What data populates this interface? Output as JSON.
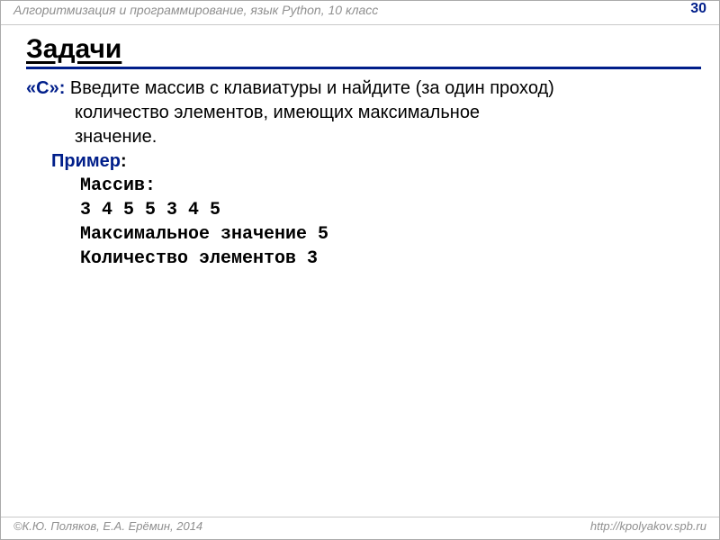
{
  "header": {
    "course": "Алгоритмизация и программирование, язык Python, 10 класс",
    "page": "30"
  },
  "title": "Задачи",
  "task": {
    "label": "«C»:",
    "line1_after_label": " Введите массив с клавиатуры и найдите (за один проход)",
    "line2": "количество элементов, имеющих максимальное",
    "line3": "значение."
  },
  "example": {
    "label": "Пример",
    "colon": ":",
    "lines": [
      "Массив:",
      "3 4 5 5 3 4 5",
      "Максимальное значение 5",
      "Количество элементов 3"
    ]
  },
  "footer": {
    "authors": "К.Ю. Поляков, Е.А. Ерёмин, 2014",
    "url": "http://kpolyakov.spb.ru"
  }
}
